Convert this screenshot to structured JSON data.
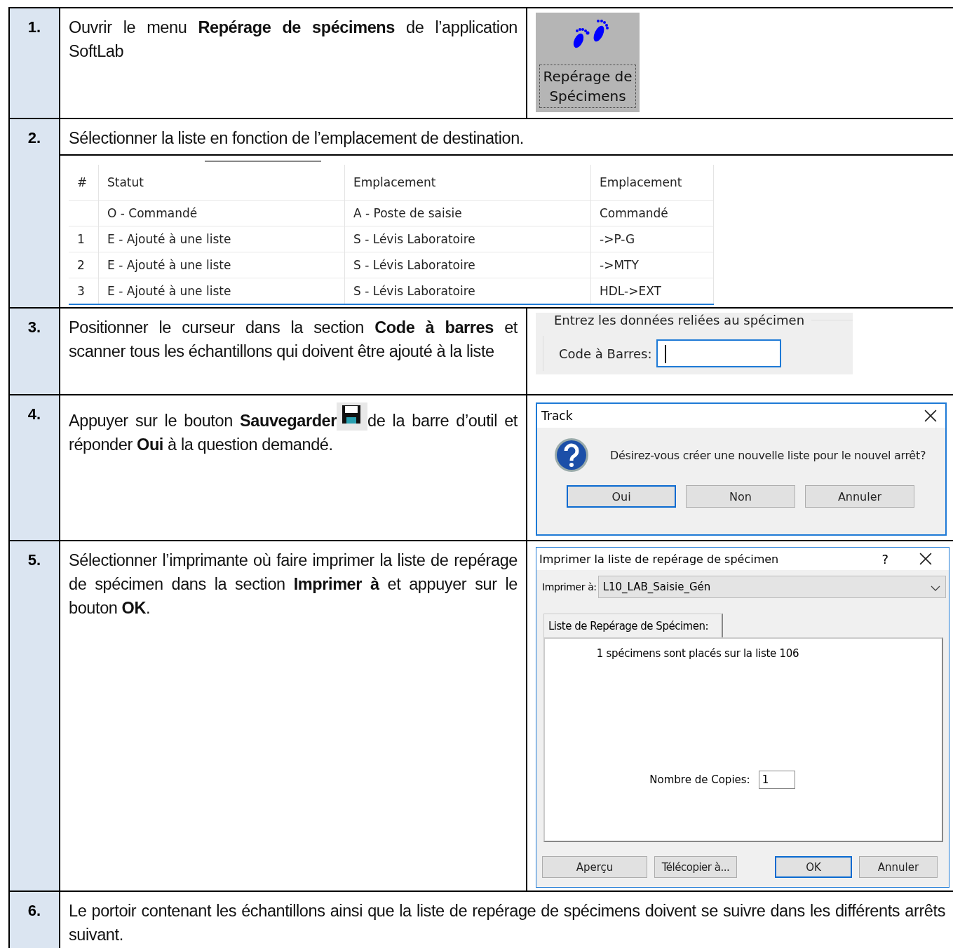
{
  "steps": [
    {
      "number": "1.",
      "text_parts": [
        "Ouvrir le menu **Repérage de spécimens** de l’application SoftLab"
      ],
      "figure": {
        "kind": "menu_button",
        "label_lines": [
          "Repérage de",
          "Spécimens"
        ]
      }
    },
    {
      "number": "2.",
      "text_parts": [
        "Sélectionner la liste en fonction de l’emplacement de destination."
      ],
      "figure": {
        "kind": "grid",
        "columns": [
          "#",
          "Statut",
          "Emplacement",
          "Emplacement"
        ],
        "rows": [
          {
            "statut": "O - Commandé",
            "emplacement": "A - Poste de saisie",
            "destination": "Commandé"
          },
          {
            "number": "1",
            "statut": "E - Ajouté à une liste",
            "emplacement": "S - Lévis Laboratoire",
            "destination": "->P-G"
          },
          {
            "number": "2",
            "statut": "E - Ajouté à une liste",
            "emplacement": "S - Lévis Laboratoire",
            "destination": "->MTY"
          },
          {
            "number": "3",
            "statut": "E - Ajouté à une liste",
            "emplacement": "S - Lévis Laboratoire",
            "destination": "HDL->EXT"
          }
        ]
      }
    },
    {
      "number": "3.",
      "text_parts": [
        "Positionner le curseur dans la section **Code à barres** et scanner tous les échantillons qui doivent être ajouté à la liste"
      ],
      "figure": {
        "kind": "barcode",
        "legend": "Entrez les données reliées au spécimen",
        "label": "Code à Barres:",
        "focused": true
      }
    },
    {
      "number": "4.",
      "text_parts": [
        "Appuyer sur le bouton **Sauvegarder**",
        "de la barre d’outil et réponder **Oui** à la question demandé."
      ],
      "figure": {
        "kind": "question_dialog",
        "title": "Track",
        "message": "Désirez-vous créer une nouvelle liste pour le nouvel arrêt?",
        "buttons": [
          {
            "label": "Oui",
            "selected": true
          },
          {
            "label": "Non",
            "selected": false
          },
          {
            "label": "Annuler",
            "selected": false
          }
        ]
      }
    },
    {
      "number": "5.",
      "text_parts": [
        "Sélectionner l’imprimante où faire imprimer la liste de repérage de spécimen dans la section **Imprimer à** et appuyer sur le bouton **OK**."
      ],
      "figure": {
        "kind": "print_dialog",
        "title": "Imprimer la liste de repérage de spécimen",
        "help": "?",
        "printer_label": "Imprimer à:",
        "printer": "L10_LAB_Saisie_Gén",
        "tab": "Liste de Repérage de Spécimen:",
        "message": "1 spécimens sont placés sur la liste 106",
        "copies_label": "Nombre de Copies:",
        "copies": "1",
        "buttons": [
          {
            "label": "Aperçu",
            "selected": false
          },
          {
            "label": "Télécopier à...",
            "selected": false
          },
          {
            "label": "OK",
            "selected": true
          },
          {
            "label": "Annuler",
            "selected": false
          }
        ]
      }
    },
    {
      "number": "6.",
      "text_parts": [
        "Le portoir contenant les échantillons ainsi que la liste de repérage de spécimens doivent se suivre dans les différents arrêts suivant."
      ]
    }
  ]
}
